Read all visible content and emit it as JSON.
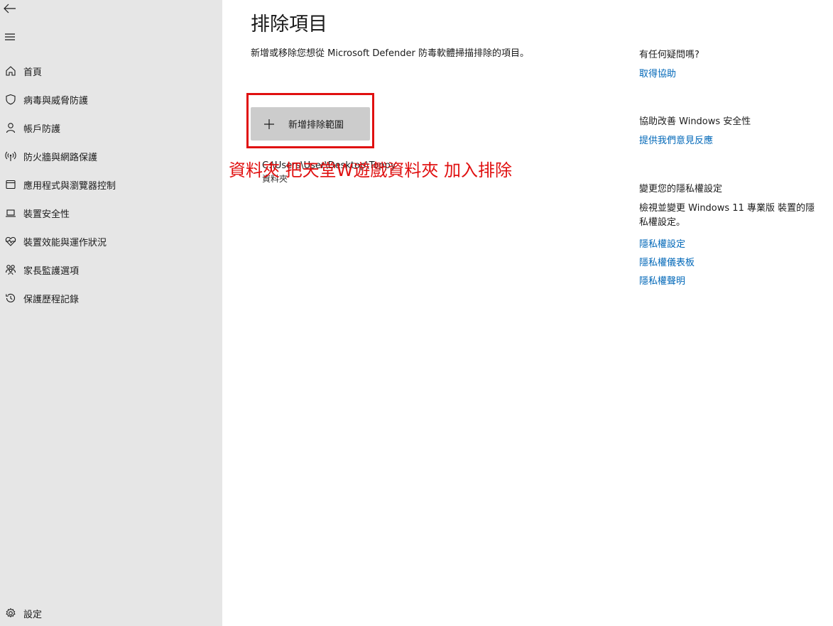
{
  "sidebar": {
    "items": [
      {
        "label": "首頁",
        "icon": "home-icon"
      },
      {
        "label": "病毒與威脅防護",
        "icon": "shield-icon"
      },
      {
        "label": "帳戶防護",
        "icon": "person-icon"
      },
      {
        "label": "防火牆與網路保護",
        "icon": "antenna-icon"
      },
      {
        "label": "應用程式與瀏覽器控制",
        "icon": "app-window-icon"
      },
      {
        "label": "裝置安全性",
        "icon": "laptop-icon"
      },
      {
        "label": "裝置效能與運作狀況",
        "icon": "heart-pulse-icon"
      },
      {
        "label": "家長監護選項",
        "icon": "family-icon"
      },
      {
        "label": "保護歷程記錄",
        "icon": "history-icon"
      }
    ],
    "settings_label": "設定"
  },
  "main": {
    "title": "排除項目",
    "description": "新增或移除您想從 Microsoft Defender 防毒軟體掃描排除的項目。",
    "add_button_label": "新增排除範圍",
    "exclusion": {
      "path": "C:\\Users\\User\\Desktop\\Toppy",
      "type": "資料夾"
    },
    "annotation": "資料夾 把天堂W遊戲資料夾 加入排除",
    "annotation_color": "#e01010"
  },
  "right": {
    "help_heading": "有任何疑問嗎?",
    "help_link": "取得協助",
    "improve_heading": "協助改善 Windows 安全性",
    "improve_link": "提供我們意見反應",
    "privacy_heading": "變更您的隱私權設定",
    "privacy_text": "檢視並變更 Windows 11 專業版 裝置的隱私權設定。",
    "privacy_links": [
      "隱私權設定",
      "隱私權儀表板",
      "隱私權聲明"
    ]
  },
  "colors": {
    "sidebar_bg": "#e6e6e6",
    "link": "#0067b8",
    "button_bg": "#cccccc",
    "highlight": "#e01010"
  }
}
